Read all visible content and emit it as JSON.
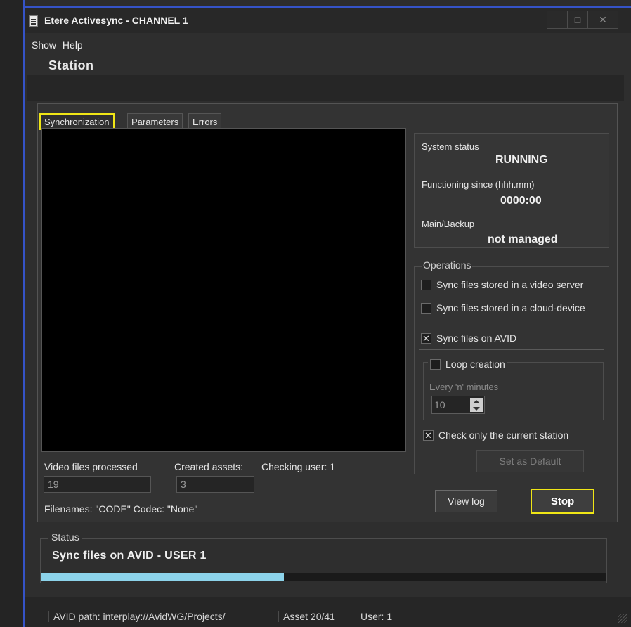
{
  "window": {
    "title": "Etere Activesync - CHANNEL 1",
    "minimize_glyph": "_",
    "maximize_glyph": "□",
    "close_glyph": "✕"
  },
  "menu": {
    "items": [
      "Show",
      "Help"
    ]
  },
  "header": {
    "station": "Station"
  },
  "tabs": [
    {
      "label": "Synchronization",
      "active": true
    },
    {
      "label": "Parameters",
      "active": false
    },
    {
      "label": "Errors",
      "active": false
    }
  ],
  "sync": {
    "video_files_label": "Video files processed",
    "video_files_value": "19",
    "created_assets_label": "Created assets:",
    "created_assets_value": "3",
    "checking_user": "Checking user: 1",
    "filenames_codec": "Filenames: \"CODE\"  Codec: \"None\""
  },
  "system": {
    "status_label": "System status",
    "status_value": "RUNNING",
    "since_label": "Functioning since (hhh.mm)",
    "since_value": "0000:00",
    "main_backup_label": "Main/Backup",
    "main_backup_value": "not managed"
  },
  "operations": {
    "legend": "Operations",
    "video_server": {
      "label": "Sync files stored in a video server",
      "checked": false
    },
    "cloud_device": {
      "label": "Sync files stored in a cloud-device",
      "checked": false
    },
    "avid": {
      "label": "Sync files on AVID",
      "checked": true
    },
    "loop_creation": {
      "label": "Loop creation",
      "checked": false
    },
    "every_label": "Every 'n' minutes",
    "every_value": "10",
    "current_station": {
      "label": "Check only the current station",
      "checked": true
    },
    "set_default_label": "Set as Default",
    "check_mark": "✕"
  },
  "actions": {
    "view_log": "View log",
    "stop": "Stop"
  },
  "status": {
    "legend": "Status",
    "message": "Sync files on AVID  -  USER 1",
    "progress": 0.43
  },
  "statusbar": {
    "avid_path": "AVID path: interplay://AvidWG/Projects/",
    "asset": "Asset 20/41",
    "user": "User: 1"
  },
  "colors": {
    "highlight": "#f0e616",
    "progress": "#8cd3ea",
    "accent_border": "#3553c7"
  }
}
